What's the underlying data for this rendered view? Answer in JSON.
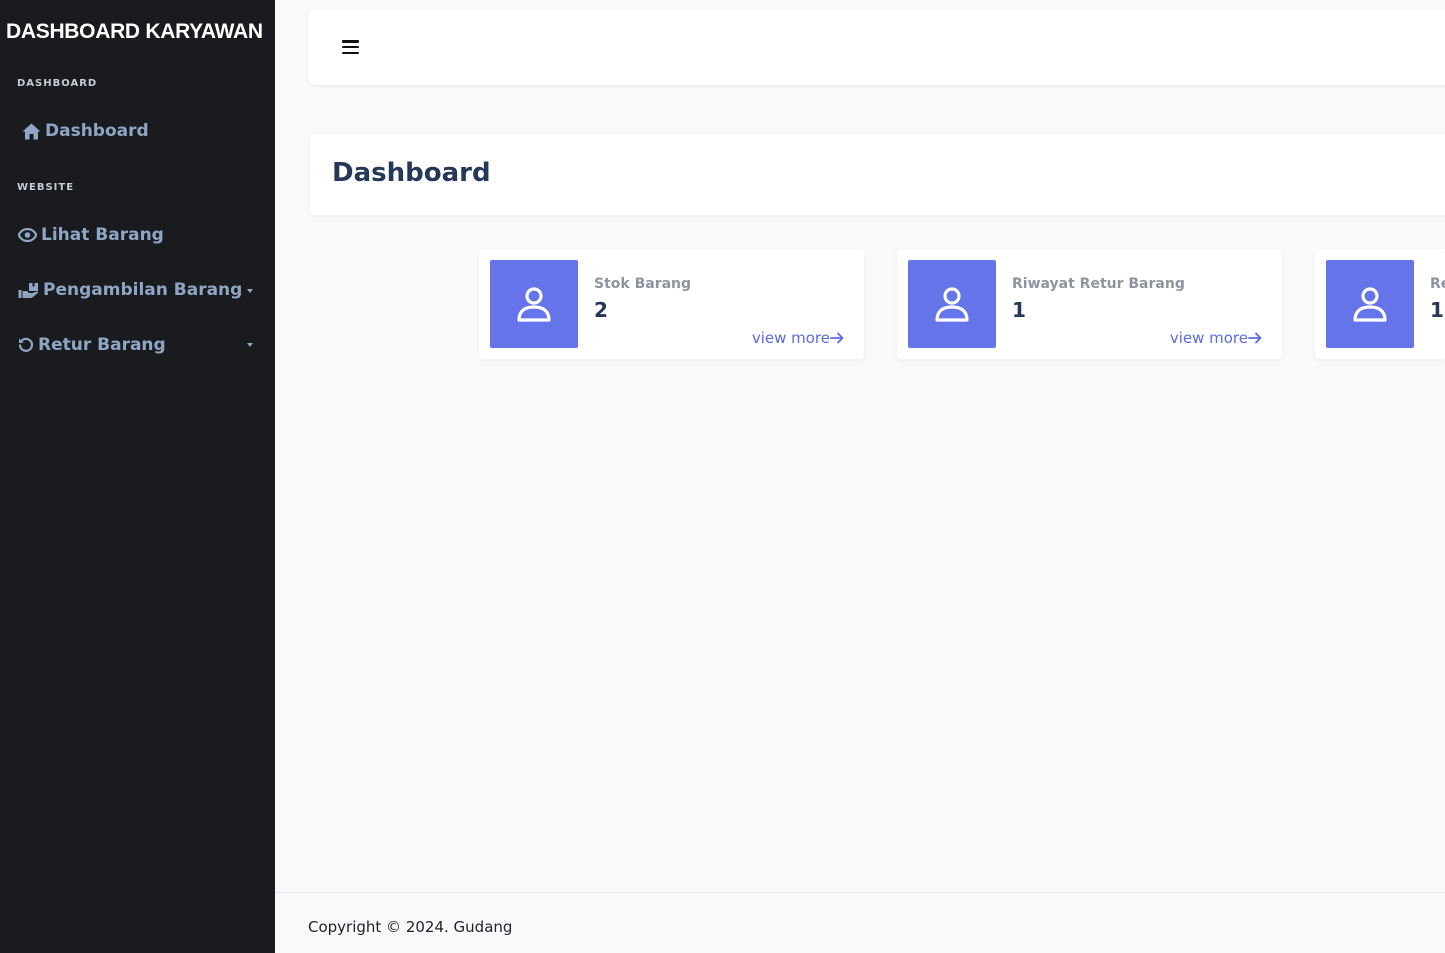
{
  "sidebar": {
    "brand": "DASHBOARD KARYAWAN",
    "sections": [
      {
        "label": "DASHBOARD"
      },
      {
        "label": "WEBSITE"
      }
    ],
    "items": [
      {
        "label": "Dashboard",
        "icon": "home-icon"
      },
      {
        "label": "Lihat Barang",
        "icon": "eye-icon"
      },
      {
        "label": "Pengambilan Barang",
        "icon": "hand-box-icon",
        "has_caret": true
      },
      {
        "label": "Retur Barang",
        "icon": "rotate-left-icon",
        "has_caret": true
      }
    ]
  },
  "topbar": {
    "menu_icon": "hamburger-icon"
  },
  "header": {
    "title": "Dashboard"
  },
  "cards": [
    {
      "label": "Stok Barang",
      "value": "2",
      "link": "view more",
      "icon": "user-icon"
    },
    {
      "label": "Riwayat Retur Barang",
      "value": "1",
      "link": "view more",
      "icon": "user-icon"
    },
    {
      "label": "Re",
      "value": "1",
      "icon": "user-icon"
    }
  ],
  "footer": {
    "copyright": "Copyright © 2024. Gudang"
  },
  "colors": {
    "sidebar_bg": "#191b1f",
    "nav_text": "#8ea6c3",
    "accent": "#6674ea",
    "title": "#253858",
    "page_bg": "#f8f9fa"
  }
}
